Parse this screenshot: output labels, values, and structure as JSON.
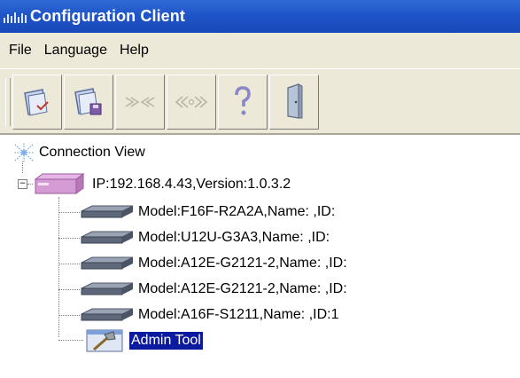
{
  "window": {
    "title": "Configuration Client"
  },
  "menu": [
    "File",
    "Language",
    "Help"
  ],
  "toolbar": {
    "buttons": [
      {
        "icon": "folder-open-icon",
        "enabled": true
      },
      {
        "icon": "folder-save-icon",
        "enabled": true
      },
      {
        "icon": "disconnect-icon",
        "enabled": false
      },
      {
        "icon": "connect-icon",
        "enabled": false
      },
      {
        "icon": "help-icon",
        "enabled": true
      },
      {
        "icon": "exit-door-icon",
        "enabled": true
      }
    ]
  },
  "tree": {
    "root": "Connection View",
    "controller": "IP:192.168.4.43,Version:1.0.3.2",
    "modules": [
      "Model:F16F-R2A2A,Name: ,ID:",
      "Model:U12U-G3A3,Name: ,ID:",
      "Model:A12E-G2121-2,Name: ,ID:",
      "Model:A12E-G2121-2,Name: ,ID:",
      "Model:A16F-S1211,Name: ,ID:1"
    ],
    "admin_tool": "Admin Tool",
    "selected": "Admin Tool"
  },
  "colors": {
    "title_bar": "#1f55c9",
    "selection": "#0b1a9e",
    "chrome": "#ece9d8"
  }
}
